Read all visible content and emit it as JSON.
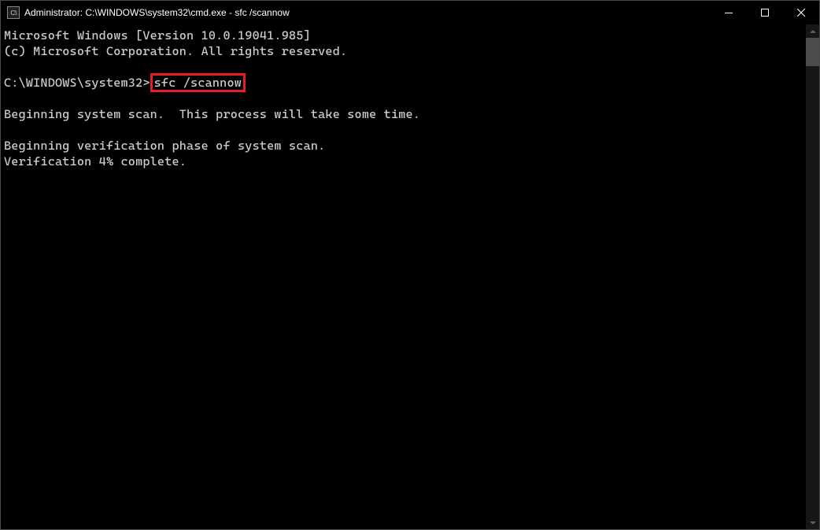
{
  "window": {
    "title": "Administrator: C:\\WINDOWS\\system32\\cmd.exe - sfc  /scannow",
    "icon_label": "C:\\"
  },
  "terminal": {
    "line1": "Microsoft Windows [Version 10.0.19041.985]",
    "line2": "(c) Microsoft Corporation. All rights reserved.",
    "blank1": "",
    "prompt": "C:\\WINDOWS\\system32>",
    "command_highlighted": "sfc /scannow",
    "blank2": "",
    "line5": "Beginning system scan.  This process will take some time.",
    "blank3": "",
    "line7": "Beginning verification phase of system scan.",
    "line8": "Verification 4% complete."
  }
}
